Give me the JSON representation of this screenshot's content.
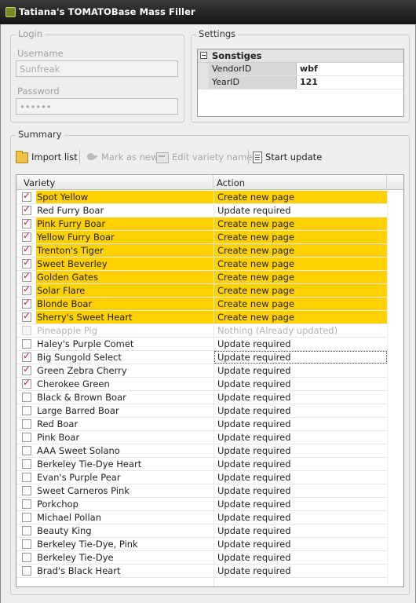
{
  "window": {
    "title": "Tatiana's TOMATOBase Mass Filler"
  },
  "login": {
    "legend": "Login",
    "username_label": "Username",
    "username_value": "Sunfreak",
    "password_label": "Password",
    "password_value": "••••••"
  },
  "settings": {
    "legend": "Settings",
    "category": "Sonstiges",
    "properties": [
      {
        "key": "VendorID",
        "value": "wbf"
      },
      {
        "key": "YearID",
        "value": "121"
      }
    ]
  },
  "summary": {
    "legend": "Summary",
    "toolbar": {
      "import": "Import list",
      "mark_new": "Mark as new",
      "edit_name": "Edit variety name",
      "start": "Start update"
    },
    "columns": {
      "variety": "Variety",
      "action": "Action"
    },
    "rows": [
      {
        "variety": "Spot Yellow",
        "action": "Create new page",
        "checked": true,
        "highlight": true
      },
      {
        "variety": "Red Furry Boar",
        "action": "Update required",
        "checked": true,
        "highlight": false
      },
      {
        "variety": "Pink Furry Boar",
        "action": "Create new page",
        "checked": true,
        "highlight": true
      },
      {
        "variety": "Yellow Furry Boar",
        "action": "Create new page",
        "checked": true,
        "highlight": true
      },
      {
        "variety": "Trenton's Tiger",
        "action": "Create new page",
        "checked": true,
        "highlight": true
      },
      {
        "variety": "Sweet Beverley",
        "action": "Create new page",
        "checked": true,
        "highlight": true
      },
      {
        "variety": "Golden Gates",
        "action": "Create new page",
        "checked": true,
        "highlight": true
      },
      {
        "variety": "Solar Flare",
        "action": "Create new page",
        "checked": true,
        "highlight": true
      },
      {
        "variety": "Blonde Boar",
        "action": "Create new page",
        "checked": true,
        "highlight": true
      },
      {
        "variety": "Sherry's Sweet Heart",
        "action": "Create new page",
        "checked": true,
        "highlight": true
      },
      {
        "variety": "Pineapple Pig",
        "action": "Nothing (Already updated)",
        "checked": false,
        "disabled": true
      },
      {
        "variety": "Haley's Purple Comet",
        "action": "Update required",
        "checked": false
      },
      {
        "variety": "Big Sungold Select",
        "action": "Update required",
        "checked": true,
        "focused": true
      },
      {
        "variety": "Green Zebra Cherry",
        "action": "Update required",
        "checked": true
      },
      {
        "variety": "Cherokee Green",
        "action": "Update required",
        "checked": true
      },
      {
        "variety": "Black & Brown Boar",
        "action": "Update required",
        "checked": false
      },
      {
        "variety": "Large Barred Boar",
        "action": "Update required",
        "checked": false
      },
      {
        "variety": "Red Boar",
        "action": "Update required",
        "checked": false
      },
      {
        "variety": "Pink Boar",
        "action": "Update required",
        "checked": false
      },
      {
        "variety": "AAA Sweet Solano",
        "action": "Update required",
        "checked": false
      },
      {
        "variety": "Berkeley Tie-Dye Heart",
        "action": "Update required",
        "checked": false
      },
      {
        "variety": "Evan's Purple Pear",
        "action": "Update required",
        "checked": false
      },
      {
        "variety": "Sweet Carneros Pink",
        "action": "Update required",
        "checked": false
      },
      {
        "variety": "Porkchop",
        "action": "Update required",
        "checked": false
      },
      {
        "variety": "Michael Pollan",
        "action": "Update required",
        "checked": false
      },
      {
        "variety": "Beauty King",
        "action": "Update required",
        "checked": false
      },
      {
        "variety": "Berkeley Tie-Dye, Pink",
        "action": "Update required",
        "checked": false
      },
      {
        "variety": "Berkeley Tie-Dye",
        "action": "Update required",
        "checked": false
      },
      {
        "variety": "Brad's Black Heart",
        "action": "Update required",
        "checked": false
      }
    ]
  },
  "colors": {
    "highlight": "#ffd100",
    "check": "#c0203a",
    "titlebar": "#1e1e1e"
  }
}
